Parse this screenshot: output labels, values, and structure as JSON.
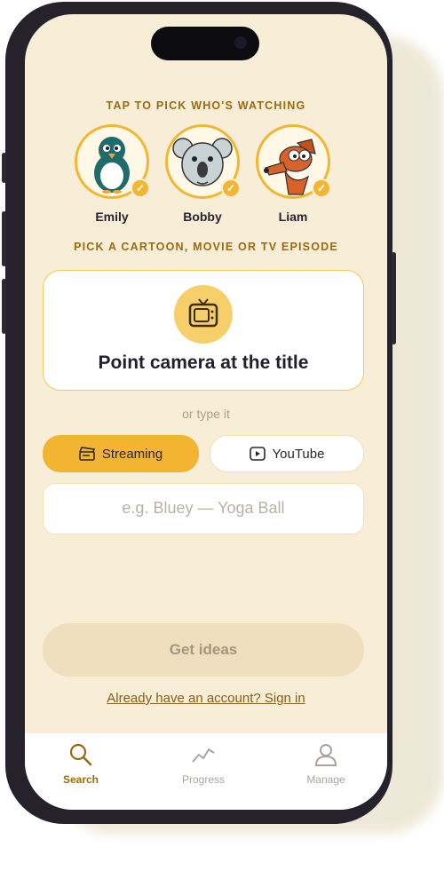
{
  "watchers_label": "TAP TO PICK WHO'S WATCHING",
  "watchers": [
    {
      "name": "Emily",
      "icon": "penguin-icon"
    },
    {
      "name": "Bobby",
      "icon": "koala-icon"
    },
    {
      "name": "Liam",
      "icon": "dog-icon"
    }
  ],
  "pick_label": "PICK A CARTOON, MOVIE OR TV EPISODE",
  "camera_card": {
    "title": "Point camera at the title",
    "icon": "tv-icon"
  },
  "or_type": "or type it",
  "source_tabs": [
    {
      "label": "Streaming",
      "icon": "clapperboard-icon",
      "selected": true
    },
    {
      "label": "YouTube",
      "icon": "play-icon",
      "selected": false
    }
  ],
  "search": {
    "placeholder": "e.g. Bluey — Yoga Ball",
    "value": ""
  },
  "get_ideas_label": "Get ideas",
  "signin_label": "Already have an account? Sign in",
  "tabs": [
    {
      "label": "Search",
      "icon": "search-icon",
      "active": true
    },
    {
      "label": "Progress",
      "icon": "chart-line-icon",
      "active": false
    },
    {
      "label": "Manage",
      "icon": "user-icon",
      "active": false
    }
  ],
  "colors": {
    "accent": "#f2b431",
    "background": "#f8edd6",
    "accent_text": "#9a6a12"
  }
}
